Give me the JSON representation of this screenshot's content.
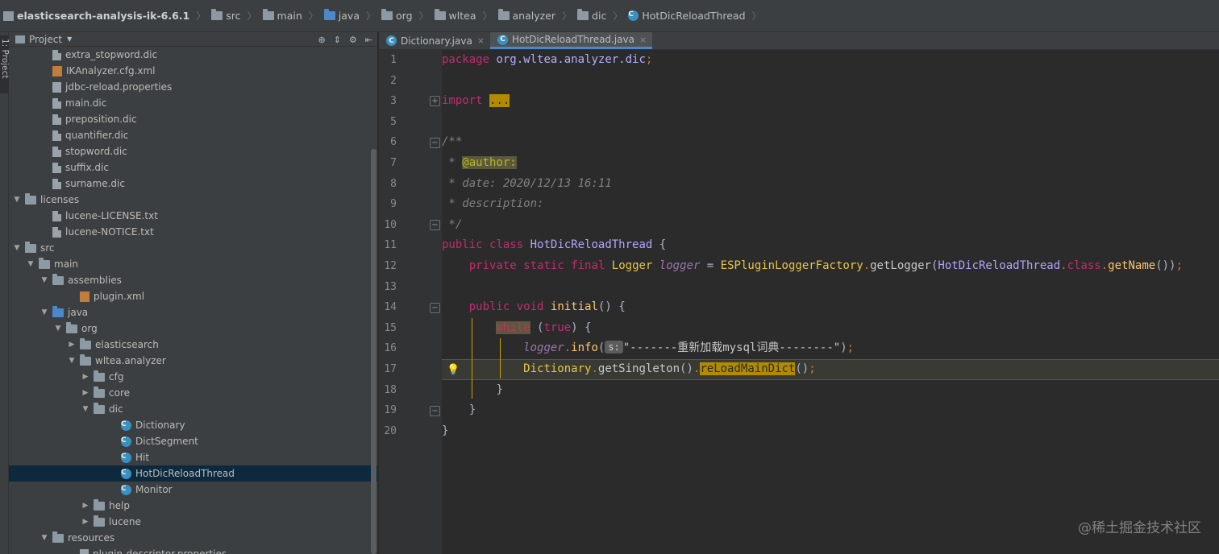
{
  "breadcrumb": [
    {
      "label": "elasticsearch-analysis-ik-6.6.1",
      "icon": "module-icon",
      "bold": true
    },
    {
      "label": "src",
      "icon": "folder-icon"
    },
    {
      "label": "main",
      "icon": "folder-icon"
    },
    {
      "label": "java",
      "icon": "folder-blue-icon"
    },
    {
      "label": "org",
      "icon": "package-icon"
    },
    {
      "label": "wltea",
      "icon": "package-icon"
    },
    {
      "label": "analyzer",
      "icon": "package-icon"
    },
    {
      "label": "dic",
      "icon": "package-icon"
    },
    {
      "label": "HotDicReloadThread",
      "icon": "class-icon"
    }
  ],
  "toolstrip": {
    "project_tab": "1: Project"
  },
  "project_panel": {
    "title": "Project"
  },
  "tree": [
    {
      "label": "extra_stopword.dic",
      "depth": 3,
      "icon": "file",
      "arrow": ""
    },
    {
      "label": "IKAnalyzer.cfg.xml",
      "depth": 3,
      "icon": "xml",
      "arrow": ""
    },
    {
      "label": "jdbc-reload.properties",
      "depth": 3,
      "icon": "props",
      "arrow": ""
    },
    {
      "label": "main.dic",
      "depth": 3,
      "icon": "file",
      "arrow": ""
    },
    {
      "label": "preposition.dic",
      "depth": 3,
      "icon": "file",
      "arrow": ""
    },
    {
      "label": "quantifier.dic",
      "depth": 3,
      "icon": "file",
      "arrow": ""
    },
    {
      "label": "stopword.dic",
      "depth": 3,
      "icon": "file",
      "arrow": ""
    },
    {
      "label": "suffix.dic",
      "depth": 3,
      "icon": "file",
      "arrow": ""
    },
    {
      "label": "surname.dic",
      "depth": 3,
      "icon": "file",
      "arrow": ""
    },
    {
      "label": "licenses",
      "depth": 1,
      "icon": "folder",
      "arrow": "down"
    },
    {
      "label": "lucene-LICENSE.txt",
      "depth": 3,
      "icon": "file",
      "arrow": ""
    },
    {
      "label": "lucene-NOTICE.txt",
      "depth": 3,
      "icon": "file",
      "arrow": ""
    },
    {
      "label": "src",
      "depth": 1,
      "icon": "folder",
      "arrow": "down"
    },
    {
      "label": "main",
      "depth": 2,
      "icon": "folder",
      "arrow": "down"
    },
    {
      "label": "assemblies",
      "depth": 3,
      "icon": "folder",
      "arrow": "down"
    },
    {
      "label": "plugin.xml",
      "depth": 5,
      "icon": "xml",
      "arrow": ""
    },
    {
      "label": "java",
      "depth": 3,
      "icon": "folder-blue",
      "arrow": "down"
    },
    {
      "label": "org",
      "depth": 4,
      "icon": "package",
      "arrow": "down"
    },
    {
      "label": "elasticsearch",
      "depth": 5,
      "icon": "package",
      "arrow": "right"
    },
    {
      "label": "wltea.analyzer",
      "depth": 5,
      "icon": "package",
      "arrow": "down"
    },
    {
      "label": "cfg",
      "depth": 6,
      "icon": "package",
      "arrow": "right"
    },
    {
      "label": "core",
      "depth": 6,
      "icon": "package",
      "arrow": "right"
    },
    {
      "label": "dic",
      "depth": 6,
      "icon": "package",
      "arrow": "down"
    },
    {
      "label": "Dictionary",
      "depth": 8,
      "icon": "class",
      "arrow": ""
    },
    {
      "label": "DictSegment",
      "depth": 8,
      "icon": "class",
      "arrow": ""
    },
    {
      "label": "Hit",
      "depth": 8,
      "icon": "class",
      "arrow": ""
    },
    {
      "label": "HotDicReloadThread",
      "depth": 8,
      "icon": "class",
      "arrow": "",
      "selected": true
    },
    {
      "label": "Monitor",
      "depth": 8,
      "icon": "class",
      "arrow": ""
    },
    {
      "label": "help",
      "depth": 6,
      "icon": "package",
      "arrow": "right"
    },
    {
      "label": "lucene",
      "depth": 6,
      "icon": "package",
      "arrow": "right"
    },
    {
      "label": "resources",
      "depth": 3,
      "icon": "folder",
      "arrow": "down"
    },
    {
      "label": "plugin-descriptor.properties",
      "depth": 5,
      "icon": "props",
      "arrow": ""
    }
  ],
  "tabs": [
    {
      "label": "Dictionary.java",
      "active": false
    },
    {
      "label": "HotDicReloadThread.java",
      "active": true
    }
  ],
  "code": {
    "line_numbers": [
      "1",
      "2",
      "3",
      "5",
      "6",
      "7",
      "8",
      "9",
      "10",
      "11",
      "12",
      "13",
      "14",
      "15",
      "16",
      "17",
      "18",
      "19",
      "20"
    ],
    "caret_line": "17",
    "tokens": {
      "package_kw": "package",
      "package_name": "org.wltea.analyzer.dic",
      "import_kw": "import",
      "import_folded": "...",
      "doc_open": "/**",
      "doc_star": " * ",
      "author_tag": "@author:",
      "date_line": " * date: 2020/12/13 16:11",
      "desc_line": " * description:",
      "doc_close": " */",
      "public_kw": "public",
      "class_kw": "class",
      "class_name": "HotDicReloadThread",
      "open_brace": " {",
      "private_kw": "private",
      "static_kw": "static",
      "final_kw": "final",
      "logger_type": "Logger",
      "logger_field": "logger",
      "eq": " = ",
      "factory": "ESPluginLoggerFactory",
      "get_logger": "getLogger",
      "class_ref": "HotDicReloadThread",
      "class_dot": "class",
      "get_name": "getName",
      "void_kw": "void",
      "initial": "initial",
      "while_kw": "while",
      "true_kw": "true",
      "info": "info",
      "s_hint": "s:",
      "message": "\"-------重新加载mysql词典--------\"",
      "dictionary": "Dictionary",
      "get_singleton": "getSingleton",
      "reload_a": "reLoadM",
      "reload_b": "ainDict",
      "close_brace": "}"
    }
  },
  "watermark": "@稀土掘金技术社区"
}
